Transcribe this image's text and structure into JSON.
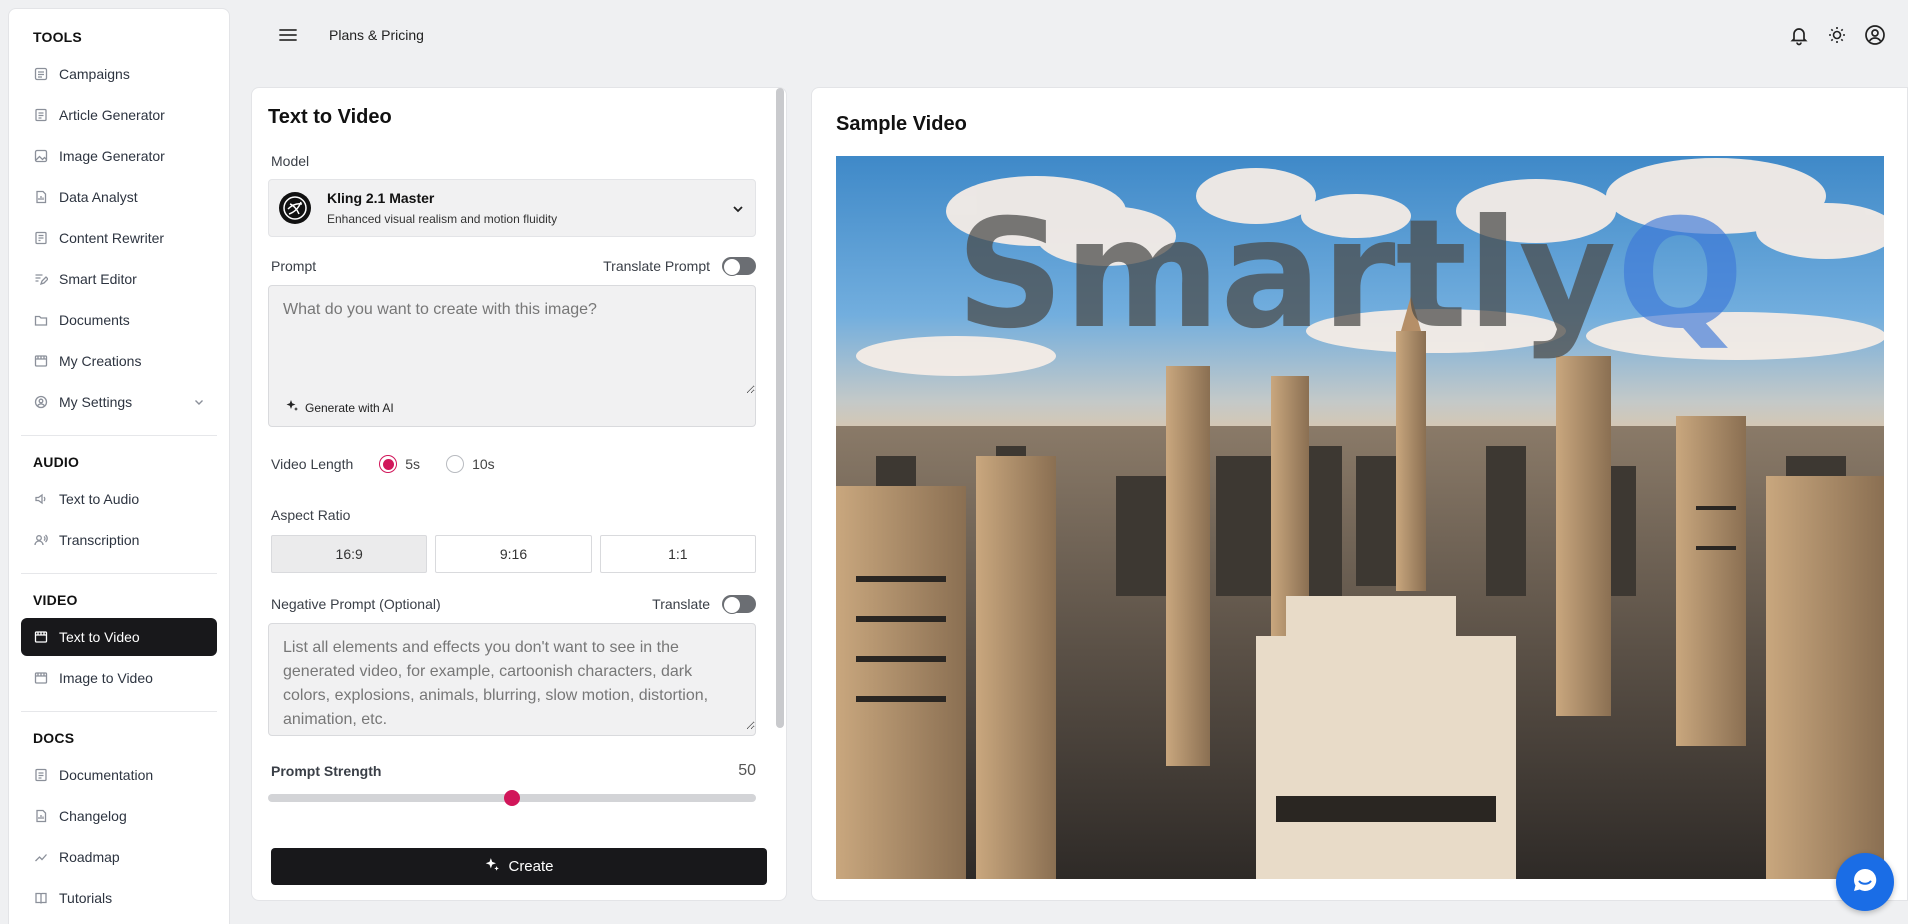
{
  "sidebar": {
    "sections": [
      {
        "title": "TOOLS",
        "items": [
          {
            "label": "Campaigns",
            "icon": "list-icon"
          },
          {
            "label": "Article Generator",
            "icon": "document-icon"
          },
          {
            "label": "Image Generator",
            "icon": "image-icon"
          },
          {
            "label": "Data Analyst",
            "icon": "file-chart-icon"
          },
          {
            "label": "Content Rewriter",
            "icon": "rewrite-icon"
          },
          {
            "label": "Smart Editor",
            "icon": "edit-lines-icon"
          },
          {
            "label": "Documents",
            "icon": "folder-icon"
          },
          {
            "label": "My Creations",
            "icon": "film-icon"
          },
          {
            "label": "My Settings",
            "icon": "user-circle-icon"
          }
        ]
      },
      {
        "title": "AUDIO",
        "items": [
          {
            "label": "Text to Audio",
            "icon": "speaker-icon"
          },
          {
            "label": "Transcription",
            "icon": "microphone-user-icon"
          }
        ]
      },
      {
        "title": "VIDEO",
        "items": [
          {
            "label": "Text to Video",
            "icon": "film-icon"
          },
          {
            "label": "Image to Video",
            "icon": "film-icon"
          }
        ]
      },
      {
        "title": "DOCS",
        "items": [
          {
            "label": "Documentation",
            "icon": "document-icon"
          },
          {
            "label": "Changelog",
            "icon": "file-chart-icon"
          },
          {
            "label": "Roadmap",
            "icon": "trend-icon"
          },
          {
            "label": "Tutorials",
            "icon": "book-icon"
          }
        ]
      }
    ],
    "active_item": "Text to Video"
  },
  "topbar": {
    "title": "Plans & Pricing",
    "icons": [
      "bell-icon",
      "sun-icon",
      "account-icon"
    ]
  },
  "form": {
    "heading": "Text to Video",
    "model_label": "Model",
    "model_name": "Kling 2.1 Master",
    "model_desc": "Enhanced visual realism and motion fluidity",
    "prompt_label": "Prompt",
    "translate_prompt_label": "Translate Prompt",
    "prompt_placeholder": "What do you want to create with this image?",
    "generate_ai_label": "Generate with AI",
    "video_length_label": "Video Length",
    "length_options": [
      "5s",
      "10s"
    ],
    "length_selected": "5s",
    "aspect_label": "Aspect Ratio",
    "aspect_options": [
      "16:9",
      "9:16",
      "1:1"
    ],
    "aspect_selected": "16:9",
    "negative_label": "Negative Prompt (Optional)",
    "translate_label": "Translate",
    "negative_placeholder": "List all elements and effects you don't want to see in the generated video, for example, cartoonish characters, dark colors, explosions, animals, blurring, slow motion, distortion, animation, etc.",
    "strength_label": "Prompt Strength",
    "strength_value": "50",
    "strength_min": 0,
    "strength_max": 100,
    "create_label": "Create"
  },
  "preview": {
    "title": "Sample Video",
    "watermark": "SmartlyQ"
  },
  "colors": {
    "accent": "#d1165a",
    "dark": "#18181b",
    "chat": "#1a6de6"
  }
}
